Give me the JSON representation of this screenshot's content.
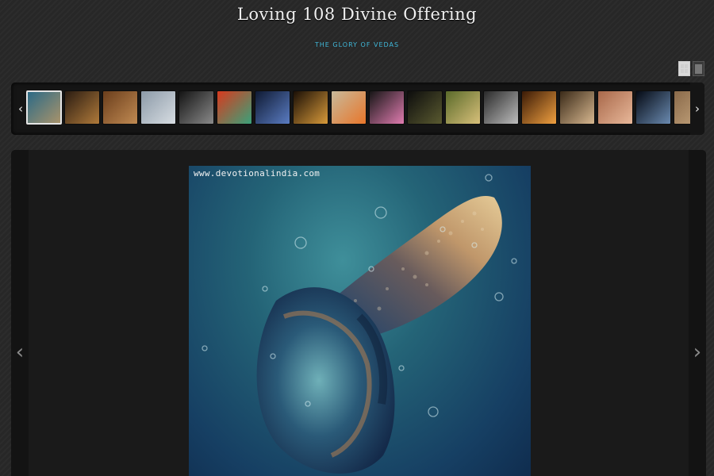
{
  "header": {
    "title": "Loving 108 Divine Offering",
    "subtitle": "THE GLORY OF VEDAS"
  },
  "view_toggle": {
    "options": [
      "grid-view",
      "single-view"
    ],
    "active": "grid-view"
  },
  "filmstrip": {
    "prev_glyph": "‹",
    "next_glyph": "›",
    "selected_index": 0,
    "thumbnails": [
      {
        "id": "shankh",
        "colors": [
          "#2c6a86",
          "#a8936b"
        ]
      },
      {
        "id": "deity-dark",
        "colors": [
          "#2a1c12",
          "#b07a3a"
        ]
      },
      {
        "id": "painting-brown",
        "colors": [
          "#6b3e1c",
          "#c08a52"
        ]
      },
      {
        "id": "sky-clouds",
        "colors": [
          "#8c9aa8",
          "#d7dde2"
        ]
      },
      {
        "id": "dark-ghat",
        "colors": [
          "#141414",
          "#8a8a8a"
        ]
      },
      {
        "id": "temple-colorful",
        "colors": [
          "#d83a1e",
          "#3aa27a"
        ]
      },
      {
        "id": "shiva-blue",
        "colors": [
          "#0f1a33",
          "#5a7cc2"
        ]
      },
      {
        "id": "golden-idol",
        "colors": [
          "#1a0f06",
          "#d89a3a"
        ]
      },
      {
        "id": "monks-orange",
        "colors": [
          "#c8b99a",
          "#e8762a"
        ]
      },
      {
        "id": "lotus",
        "colors": [
          "#161616",
          "#e07cb0"
        ]
      },
      {
        "id": "meditation-dusk",
        "colors": [
          "#0d0d0d",
          "#5a5a30"
        ]
      },
      {
        "id": "yoga-field",
        "colors": [
          "#5a6a2a",
          "#d8c07a"
        ]
      },
      {
        "id": "hands-prayer",
        "colors": [
          "#2a2a2a",
          "#bdbdbd"
        ]
      },
      {
        "id": "lamp-sunset",
        "colors": [
          "#3a1a06",
          "#f0a040"
        ]
      },
      {
        "id": "ganga-aarti",
        "colors": [
          "#3a2a18",
          "#d8b890"
        ]
      },
      {
        "id": "river-sunrise",
        "colors": [
          "#a8684a",
          "#e8b89a"
        ]
      },
      {
        "id": "moon-night",
        "colors": [
          "#050a14",
          "#6a8ab0"
        ]
      },
      {
        "id": "partial",
        "colors": [
          "#8a6a4a",
          "#c8a880"
        ]
      }
    ]
  },
  "viewer": {
    "watermark": "www.devotionalindia.com",
    "prev_glyph": "‹",
    "next_glyph": "›"
  },
  "colors": {
    "background": "#272727",
    "accent": "#3fb7d8",
    "title": "#f0f0f0"
  }
}
